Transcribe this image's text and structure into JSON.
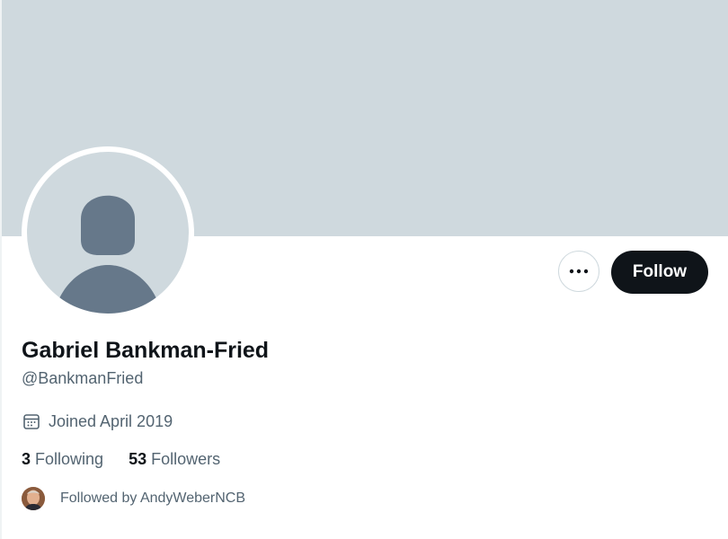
{
  "profile": {
    "display_name": "Gabriel Bankman-Fried",
    "handle": "@BankmanFried",
    "joined": "Joined April 2019",
    "following_count": "3",
    "following_label": "Following",
    "followers_count": "53",
    "followers_label": "Followers",
    "followed_by": "Followed by AndyWeberNCB"
  },
  "actions": {
    "follow_label": "Follow",
    "more_icon": "more-horizontal-icon"
  },
  "colors": {
    "banner": "#cfd9de",
    "avatar_silhouette": "#66788a",
    "follow_button": "#0f1419",
    "secondary_text": "#536471"
  }
}
